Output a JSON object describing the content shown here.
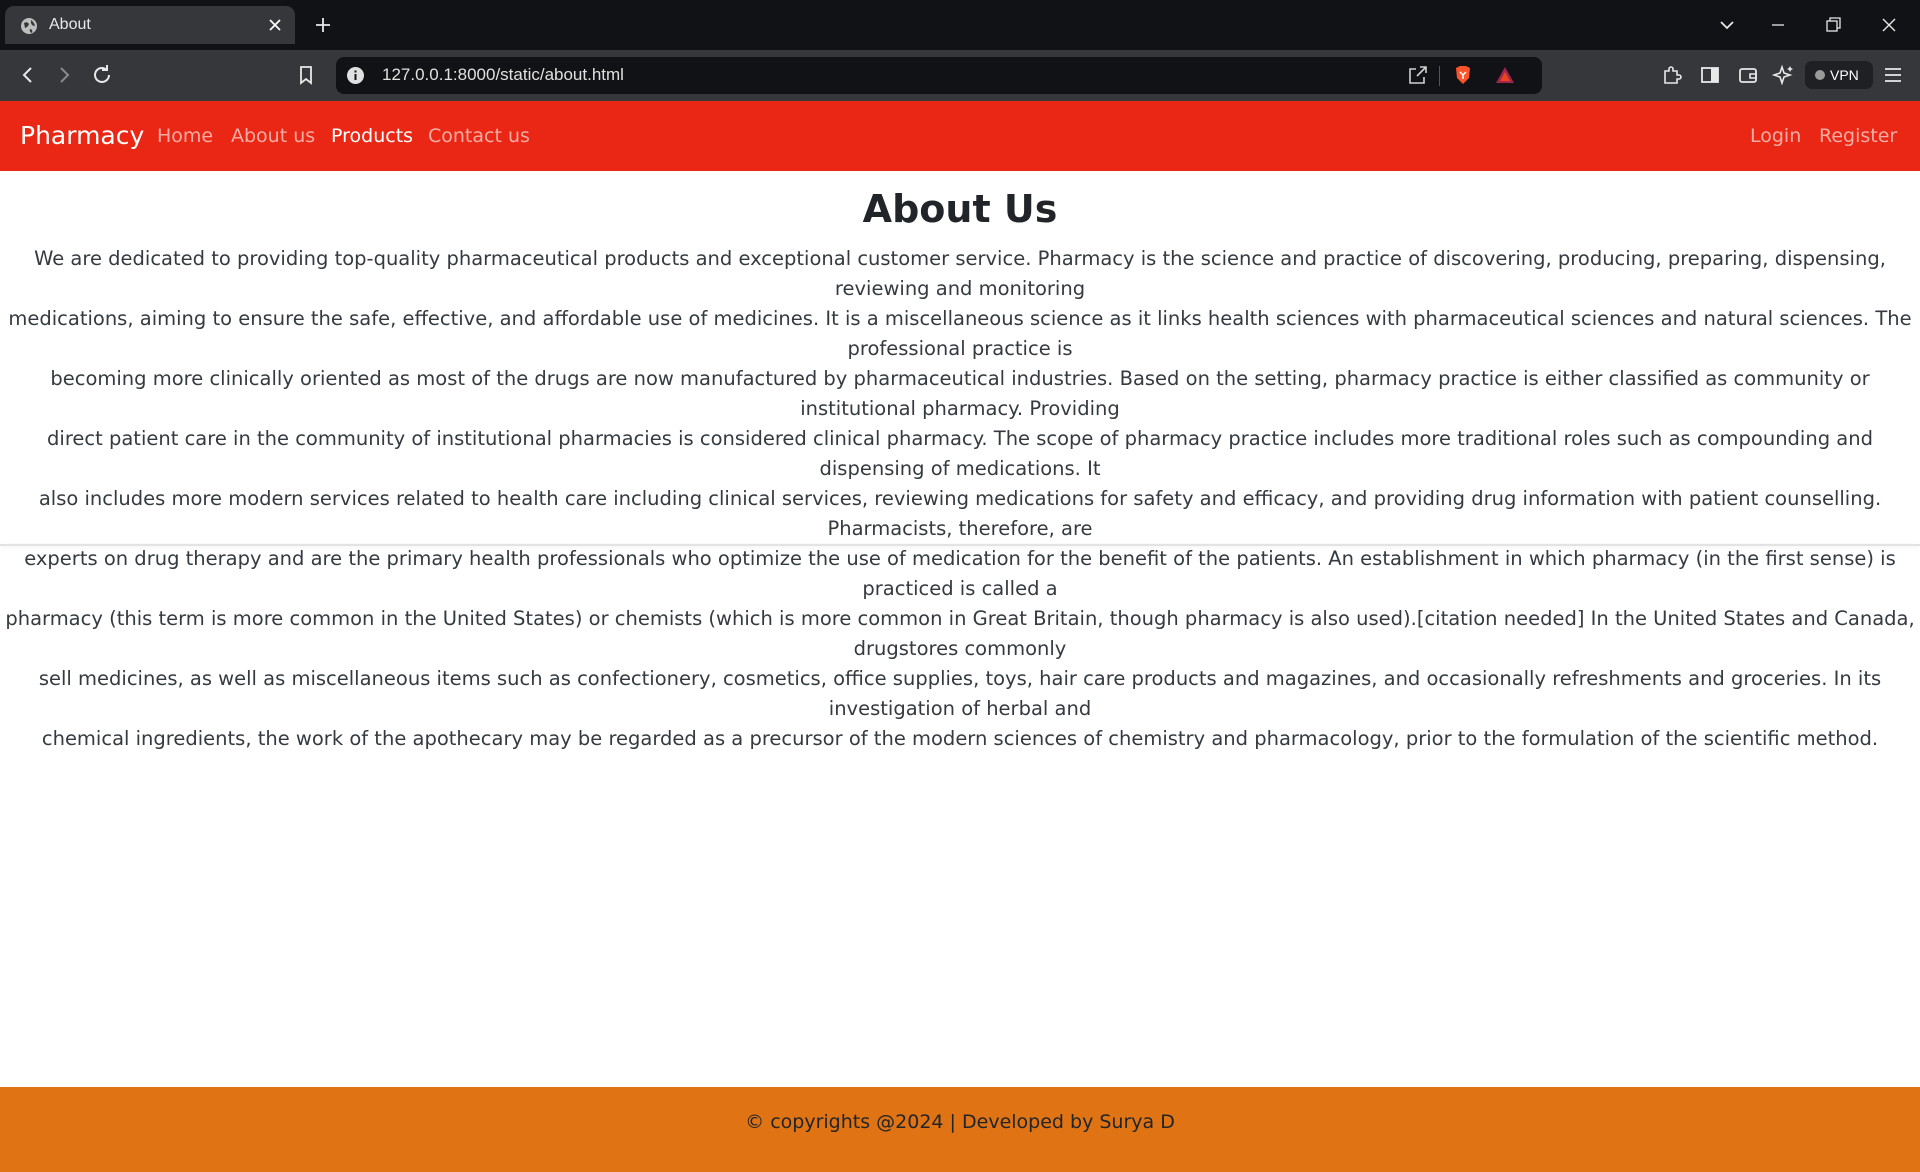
{
  "browser": {
    "tab_title": "About",
    "url": "127.0.0.1:8000/static/about.html",
    "vpn_label": "VPN",
    "icons": [
      "globe-icon",
      "close-icon",
      "plus-icon",
      "chevron-down-icon",
      "minimize-icon",
      "restore-icon",
      "close-window-icon",
      "back-icon",
      "forward-icon",
      "reload-icon",
      "bookmark-icon",
      "info-icon",
      "share-icon",
      "brave-shield-icon",
      "brave-rewards-icon",
      "extensions-icon",
      "sidebar-icon",
      "wallet-icon",
      "leo-icon",
      "menu-icon"
    ]
  },
  "navbar": {
    "brand": "Pharmacy",
    "links": [
      "Home",
      "About us",
      "Products",
      "Contact us"
    ],
    "active_link": "Products",
    "right_links": [
      "Login",
      "Register"
    ],
    "background": "#ea2714"
  },
  "main": {
    "title": "About Us",
    "lines": [
      "We are dedicated to providing top-quality pharmaceutical products and exceptional customer service. Pharmacy is the science and practice of discovering, producing, preparing, dispensing, reviewing and monitoring",
      "medications, aiming to ensure the safe, effective, and affordable use of medicines. It is a miscellaneous science as it links health sciences with pharmaceutical sciences and natural sciences. The professional practice is",
      "becoming more clinically oriented as most of the drugs are now manufactured by pharmaceutical industries. Based on the setting, pharmacy practice is either classified as community or institutional pharmacy. Providing",
      "direct patient care in the community of institutional pharmacies is considered clinical pharmacy. The scope of pharmacy practice includes more traditional roles such as compounding and dispensing of medications. It",
      "also includes more modern services related to health care including clinical services, reviewing medications for safety and efficacy, and providing drug information with patient counselling. Pharmacists, therefore, are",
      "experts on drug therapy and are the primary health professionals who optimize the use of medication for the benefit of the patients. An establishment in which pharmacy (in the first sense) is practiced is called a",
      "pharmacy (this term is more common in the United States) or chemists (which is more common in Great Britain, though pharmacy is also used).[citation needed] In the United States and Canada, drugstores commonly",
      "sell medicines, as well as miscellaneous items such as confectionery, cosmetics, office supplies, toys, hair care products and magazines, and occasionally refreshments and groceries. In its investigation of herbal and",
      "chemical ingredients, the work of the apothecary may be regarded as a precursor of the modern sciences of chemistry and pharmacology, prior to the formulation of the scientific method."
    ]
  },
  "footer": {
    "text": "© copyrights @2024 | Developed by Surya D",
    "background": "#e07314"
  }
}
